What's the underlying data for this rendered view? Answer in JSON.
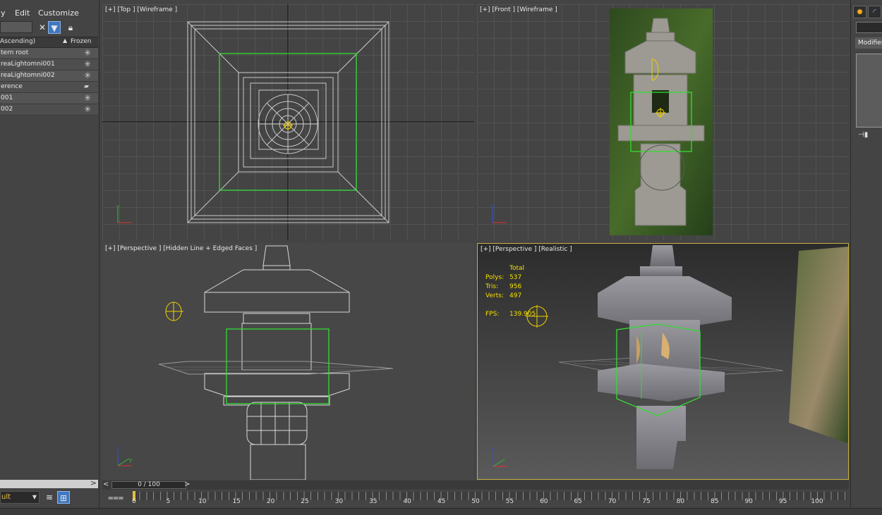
{
  "menu": {
    "items": [
      "y",
      "Edit",
      "Customize"
    ]
  },
  "scene_explorer": {
    "search_placeholder": "",
    "column_name": "Ascending)",
    "column_frozen": "Frozen",
    "rows": [
      {
        "name": "tern root"
      },
      {
        "name": "reaLightomni001"
      },
      {
        "name": "reaLightomni002"
      },
      {
        "name": "erence"
      },
      {
        "name": "001"
      },
      {
        "name": "002"
      }
    ],
    "layer_dropdown": "ult"
  },
  "viewports": {
    "top": {
      "label": "[+] [Top ] [Wireframe ]"
    },
    "front": {
      "label": "[+] [Front ] [Wireframe ]"
    },
    "perspective": {
      "label": "[+] [Perspective ] [Hidden Line + Edged Faces ]"
    },
    "realistic": {
      "label": "[+] [Perspective ] [Realistic ]",
      "stats": {
        "header": "Total",
        "polys_label": "Polys:",
        "polys": "537",
        "tris_label": "Tris:",
        "tris": "956",
        "verts_label": "Verts:",
        "verts": "497",
        "fps_label": "FPS:",
        "fps": "139.905"
      }
    }
  },
  "command_panel": {
    "modifier_list": "Modifier"
  },
  "time_slider": {
    "display": "0 / 100",
    "prev": "<",
    "next": ">",
    "current_fraction": 0
  },
  "trackbar": {
    "ticks": [
      "0",
      "5",
      "10",
      "15",
      "20",
      "25",
      "30",
      "35",
      "40",
      "45",
      "50",
      "55",
      "60",
      "65",
      "70",
      "75",
      "80",
      "85",
      "90",
      "95",
      "100"
    ]
  },
  "colors": {
    "selection_green": "#33dd33",
    "gizmo_yellow": "#f0d000",
    "active_border": "#c8b040"
  }
}
